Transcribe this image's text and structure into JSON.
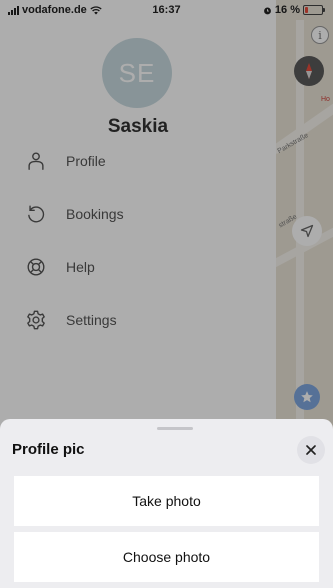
{
  "status_bar": {
    "carrier": "vodafone.de",
    "time": "16:37",
    "battery": "16 %",
    "battery_level": 0.16,
    "battery_color": "#e74c3c"
  },
  "drawer": {
    "avatar_initials": "SE",
    "avatar_color": "#c9dbe0",
    "user_name": "Saskia",
    "items": [
      {
        "label": "Profile",
        "icon": "person-icon"
      },
      {
        "label": "Bookings",
        "icon": "history-icon"
      },
      {
        "label": "Help",
        "icon": "lifebuoy-icon"
      },
      {
        "label": "Settings",
        "icon": "gear-icon"
      }
    ]
  },
  "map": {
    "streets": [
      "Parkstraße",
      "straße"
    ],
    "poi_label": "Ho"
  },
  "sheet": {
    "title": "Profile pic",
    "actions": [
      {
        "label": "Take photo"
      },
      {
        "label": "Choose photo"
      }
    ]
  }
}
